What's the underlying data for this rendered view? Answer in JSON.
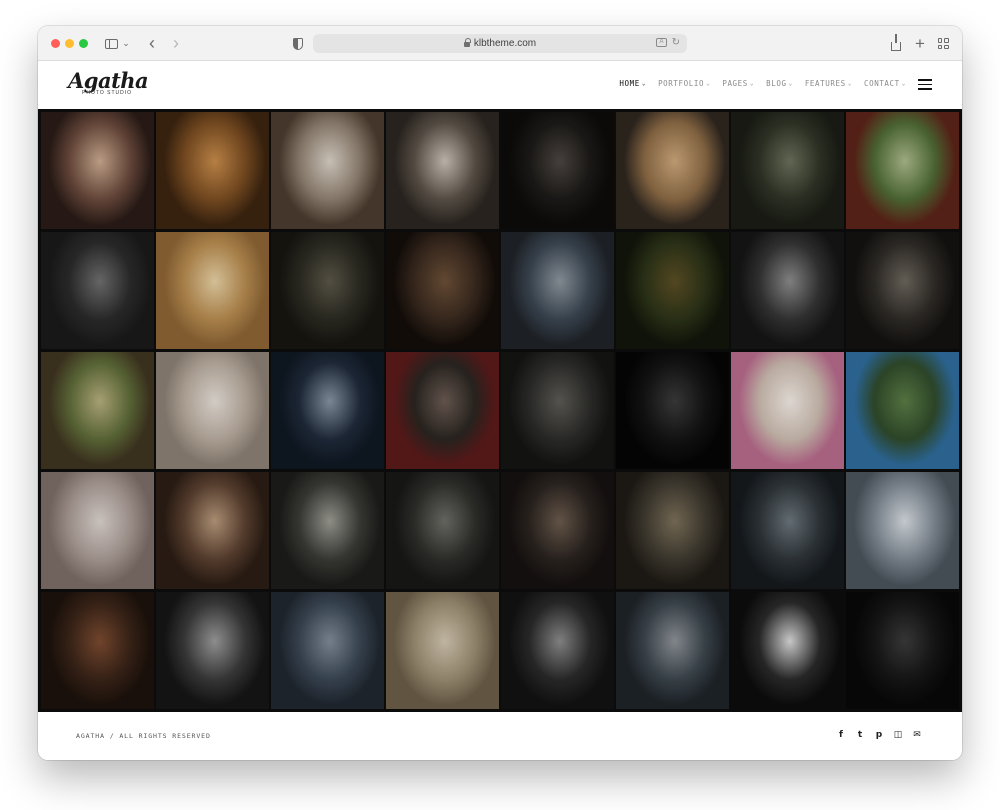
{
  "browser": {
    "url": "klbtheme.com",
    "icons": [
      "sidebar-icon",
      "chevron-down-icon",
      "back-icon",
      "forward-icon",
      "shield-icon",
      "lock-icon",
      "translate-icon",
      "reload-icon",
      "share-icon",
      "plus-icon",
      "tab-overview-icon"
    ]
  },
  "site": {
    "logo": {
      "name": "Agatha",
      "tagline": "PHOTO STUDIO"
    },
    "nav": [
      {
        "label": "HOME",
        "active": true
      },
      {
        "label": "PORTFOLIO",
        "active": false
      },
      {
        "label": "PAGES",
        "active": false
      },
      {
        "label": "BLOG",
        "active": false
      },
      {
        "label": "FEATURES",
        "active": false
      },
      {
        "label": "CONTACT",
        "active": false
      }
    ]
  },
  "gallery": {
    "photos": [
      [
        "#6b4a3d",
        "#c9a98f",
        "#2a1c17"
      ],
      [
        "#7a4d22",
        "#c58a4a",
        "#3b2410"
      ],
      [
        "#8e8070",
        "#d8cfc4",
        "#4a3b2e"
      ],
      [
        "#5a5148",
        "#c8bfb6",
        "#2b2520"
      ],
      [
        "#1c1a18",
        "#4b4540",
        "#0c0b0a"
      ],
      [
        "#8b6a45",
        "#caa57a",
        "#2e261f"
      ],
      [
        "#2f3326",
        "#6a6f5a",
        "#1a1c14"
      ],
      [
        "#4f6a35",
        "#a9b98a",
        "#5a2318"
      ],
      [
        "#2b2b2b",
        "#6e6e6e",
        "#1a1a1a"
      ],
      [
        "#b58a4f",
        "#e5cfa3",
        "#8a6334"
      ],
      [
        "#2b2a22",
        "#5a5647",
        "#161510"
      ],
      [
        "#3a2a1f",
        "#6a4e36",
        "#140e0a"
      ],
      [
        "#3b4652",
        "#8c949c",
        "#1f2328"
      ],
      [
        "#2c3318",
        "#5a4d24",
        "#12150a"
      ],
      [
        "#333333",
        "#8a8a8a",
        "#151515"
      ],
      [
        "#2e2b27",
        "#6b655c",
        "#141210"
      ],
      [
        "#5d6a38",
        "#b4ad7c",
        "#3e3320"
      ],
      [
        "#b7aa9d",
        "#e4ddd6",
        "#8a7e72"
      ],
      [
        "#1f2a3a",
        "#8593a0",
        "#0f1722"
      ],
      [
        "#2a2521",
        "#6a5a52",
        "#5a1a1a"
      ],
      [
        "#2c2c2a",
        "#5c5a55",
        "#141413"
      ],
      [
        "#141414",
        "#3a3a3a",
        "#050505"
      ],
      [
        "#c9b9ad",
        "#efe8e2",
        "#b56a8a"
      ],
      [
        "#2f4a2a",
        "#5a7a45",
        "#2e6a9a"
      ],
      [
        "#a89a94",
        "#d9d1cc",
        "#7a6c66"
      ],
      [
        "#5a4030",
        "#b6987a",
        "#2b1d14"
      ],
      [
        "#3a3a36",
        "#9a9a92",
        "#1c1c1a"
      ],
      [
        "#2e2f2b",
        "#6c6c66",
        "#171816"
      ],
      [
        "#2b2420",
        "#6a5a4c",
        "#151110"
      ],
      [
        "#3f3a30",
        "#7a6e58",
        "#1e1b16"
      ],
      [
        "#2e3438",
        "#6a757c",
        "#151a1d"
      ],
      [
        "#7d8791",
        "#d4d9de",
        "#4a535b"
      ],
      [
        "#3a2418",
        "#7a4a30",
        "#1c120c"
      ],
      [
        "#3a3a3a",
        "#9a9a9a",
        "#151515"
      ],
      [
        "#3a4654",
        "#7e8a96",
        "#1f262e"
      ],
      [
        "#9a8c72",
        "#cfc4ae",
        "#6a5d48"
      ],
      [
        "#2a2a2a",
        "#8a8a8a",
        "#121212"
      ],
      [
        "#3c454d",
        "#8c9196",
        "#1e2328"
      ],
      [
        "#2a2a2a",
        "#d8d8d8",
        "#0d0d0d"
      ],
      [
        "#161616",
        "#3a3a3a",
        "#080808"
      ]
    ]
  },
  "footer": {
    "copyright": "AGATHA / ALL RIGHTS RESERVED",
    "social": [
      {
        "name": "facebook-icon",
        "glyph": "f"
      },
      {
        "name": "twitter-icon",
        "glyph": "t"
      },
      {
        "name": "pinterest-icon",
        "glyph": "p"
      },
      {
        "name": "instagram-icon",
        "glyph": "◫"
      },
      {
        "name": "email-icon",
        "glyph": "✉"
      }
    ]
  }
}
